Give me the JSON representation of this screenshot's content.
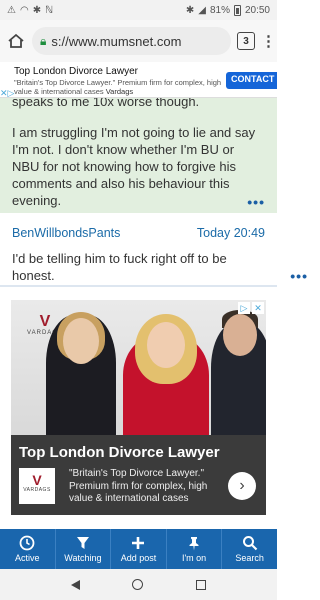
{
  "status_bar": {
    "left_icons": "⚠ ✉ ◎ 🔇",
    "battery": "81%",
    "time": "20:50",
    "right_icons": "✱ 📶"
  },
  "browser": {
    "url": "s://www.mumsnet.com",
    "tab_count": "3"
  },
  "top_ad": {
    "title": "Top London Divorce Lawyer",
    "text": "\"Britain's Top Divorce Lawyer.\" Premium firm for complex, high value & international cases",
    "brand": "Vardags",
    "cta": "CONTACT US"
  },
  "post": {
    "cutoff_text": "speaks to me 10x worse though.",
    "body": "I am struggling I'm not going to lie and say I'm not. I don't know whether I'm BU or NBU for not knowing how to forgive his comments and also his behaviour this evening.",
    "more": "•••"
  },
  "reply": {
    "poster": "BenWillbondsPants",
    "time": "Today 20:49",
    "body": "I'd be telling him to fuck right off to be honest.",
    "more": "•••"
  },
  "display_ad": {
    "logo_mark": "V",
    "logo_word": "VARDAGS",
    "headline": "Top London Divorce Lawyer",
    "description": "\"Britain's Top Divorce Lawyer.\" Premium firm for complex, high value & international cases",
    "arrow": "›"
  },
  "bottom_nav": [
    {
      "label": "Active",
      "icon": "clock-icon"
    },
    {
      "label": "Watching",
      "icon": "filter-icon"
    },
    {
      "label": "Add post",
      "icon": "plus-icon"
    },
    {
      "label": "I'm on",
      "icon": "pin-icon"
    },
    {
      "label": "Search",
      "icon": "search-icon"
    }
  ]
}
